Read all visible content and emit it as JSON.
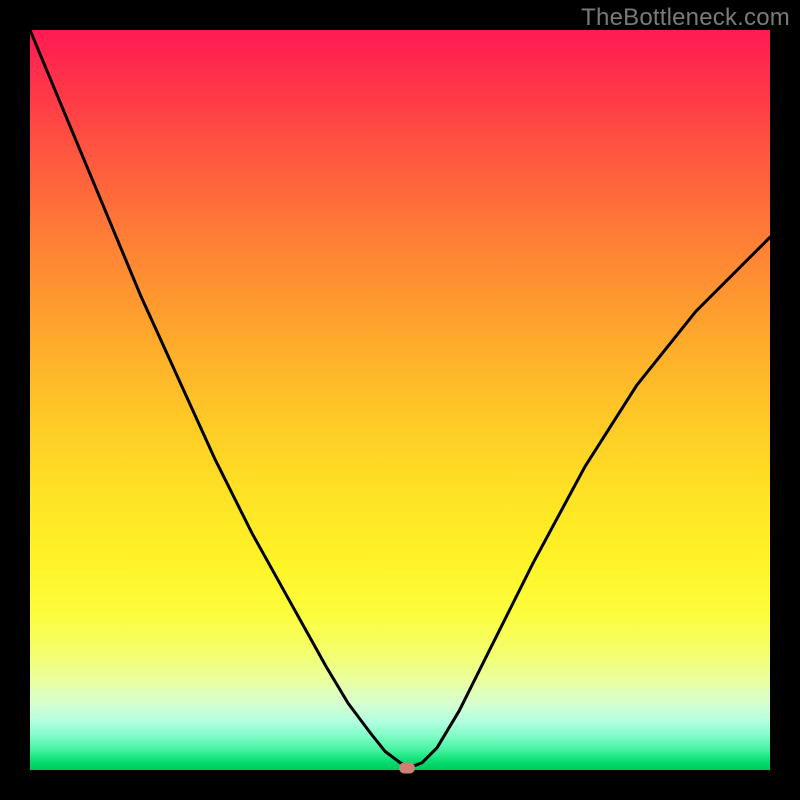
{
  "watermark": "TheBottleneck.com",
  "colors": {
    "frame": "#000000",
    "curve": "#000000",
    "marker": "#cd8074"
  },
  "chart_data": {
    "type": "line",
    "title": "",
    "xlabel": "",
    "ylabel": "",
    "xlim": [
      0,
      100
    ],
    "ylim": [
      0,
      100
    ],
    "grid": false,
    "legend": false,
    "background": "rainbow-gradient (red top → green bottom)",
    "series": [
      {
        "name": "bottleneck-curve",
        "x": [
          0,
          5,
          10,
          15,
          20,
          25,
          30,
          35,
          40,
          43,
          46,
          48,
          50,
          51,
          52,
          53,
          55,
          58,
          62,
          68,
          75,
          82,
          90,
          100
        ],
        "values": [
          100,
          88,
          76,
          64,
          53,
          42,
          32,
          23,
          14,
          9,
          5,
          2.5,
          1,
          0.5,
          0.6,
          1,
          3,
          8,
          16,
          28,
          41,
          52,
          62,
          72
        ]
      }
    ],
    "marker": {
      "x": 51,
      "y": 0.3,
      "shape": "rounded-rect"
    }
  }
}
